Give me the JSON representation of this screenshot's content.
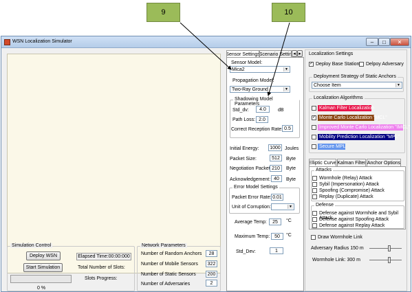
{
  "callouts": {
    "a": "9",
    "b": "10"
  },
  "window": {
    "title": "WSN Localization Simulator"
  },
  "tabs": {
    "sensor": "Sensor Settings",
    "scenario": "Scenario Settin",
    "prev": "◂",
    "next": "▸"
  },
  "sensor": {
    "model_label": "Sensor Model:",
    "model_value": "Mica2",
    "prop_label": "Propagation Model:",
    "prop_value": "Two-Ray Ground"
  },
  "shadowing": {
    "title": "Shadowing Model Parameters",
    "std_label": "Std_dv:",
    "std_value": "4.0",
    "std_unit": "dB",
    "pl_label": "Path Loss:",
    "pl_value": "2.0",
    "crr_label": "Correct Reception Rate:",
    "crr_value": "0.5"
  },
  "params": [
    {
      "label": "Initial Energy:",
      "value": "1000",
      "unit": "Joules"
    },
    {
      "label": "Packet Size:",
      "value": "512",
      "unit": "Byte"
    },
    {
      "label": "Negotiation Packet:",
      "value": "210",
      "unit": "Byte"
    },
    {
      "label": "Acknowledgement:",
      "value": "40",
      "unit": "Byte"
    }
  ],
  "error_model": {
    "title": "Error Model Settings",
    "per_label": "Packet Error Rate:",
    "per_value": "0.01",
    "unit_label": "Unit of Corruption:"
  },
  "temps": {
    "avg_label": "Average Temp:",
    "avg_value": "25",
    "max_label": "Maximum Temp:",
    "max_value": "50",
    "unit": "°C",
    "std_label": "Std_Dev:",
    "std_value": "1"
  },
  "sim": {
    "title": "Simulation Control",
    "deploy": "Deploy WSN",
    "start": "Start Simulation",
    "elapsed": "Elapsed Time:00:00:000",
    "slots": "Total Number of Slots:",
    "progress_label": "Slots Progress:",
    "percent": "0 %"
  },
  "network": {
    "title": "Network Parameters",
    "rows": [
      {
        "label": "Number of Random Anchors",
        "value": "28"
      },
      {
        "label": "Number of Mobile Sensors",
        "value": "322"
      },
      {
        "label": "Number of Static Sensors",
        "value": "200"
      },
      {
        "label": "Number of Adversaries",
        "value": "2"
      }
    ]
  },
  "loc": {
    "title": "Localization Settings",
    "deploy_bs": "Deploy Base Station",
    "deploy_adv": "Delpoy Adversary",
    "strategy_title": "Deployment Strategy of Static Anchors",
    "strategy_value": "Choose Item",
    "algs_title": "Localization Algorithms",
    "algs": [
      {
        "label": "Kalman Filter Localization",
        "bg": "#e8154a",
        "fg": "#ffffff",
        "checked": false
      },
      {
        "label": "Monte Carlo Localization \"MCL\"",
        "bg": "#8b4513",
        "fg": "#ffffff",
        "checked": true
      },
      {
        "label": "Improved Monte Carlo Localization \"IMCL\"",
        "bg": "#ee82ee",
        "fg": "#ffffff",
        "checked": false
      },
      {
        "label": "Mobility Prediction Localization \"MPL\"",
        "bg": "#000080",
        "fg": "#ffffff",
        "checked": false
      },
      {
        "label": "Secure MPL",
        "bg": "#6495ed",
        "fg": "#ffffff",
        "checked": false
      }
    ],
    "subtabs": [
      "Elliptic Curve",
      "Kalman Filter",
      "Anchor Options"
    ],
    "attacks_title": "Attacks",
    "attacks": [
      "Wormhole (Relay) Attack",
      "Sybil (Impersonation) Attack",
      "Spoofing (Compromise) Attack",
      "Replay (Duplicate) Attack"
    ],
    "defense_title": "Defense",
    "defenses": [
      "Defense against Wormhole and Sybil Attack",
      "Defense against Spoofing Attack",
      "Defense against Replay Attack"
    ],
    "draw_wormhole": "Draw Wormhole Link",
    "adv_radius": "Adversary Radius 150  m",
    "wormhole_link": "Wormhole Link:   300  m"
  }
}
